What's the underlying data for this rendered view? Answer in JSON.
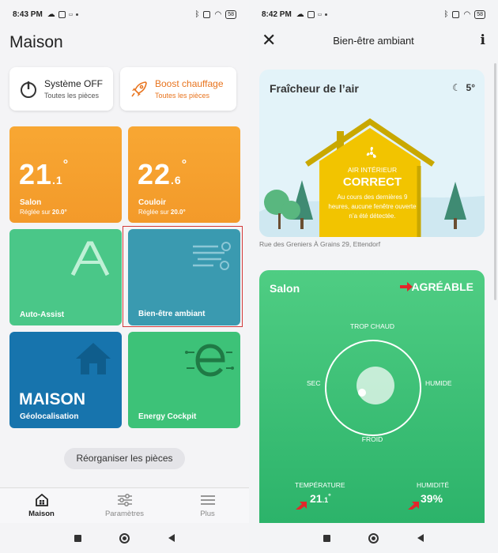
{
  "left": {
    "status": {
      "time": "8:43 PM",
      "battery": "58"
    },
    "title": "Maison",
    "quick": {
      "system": {
        "title": "Système OFF",
        "subtitle": "Toutes les pièces"
      },
      "boost": {
        "title": "Boost chauffage",
        "subtitle": "Toutes les pièces"
      }
    },
    "tiles": {
      "salon": {
        "int": "21",
        "dec": ".1",
        "deg": "°",
        "name": "Salon",
        "sub_prefix": "Réglée sur ",
        "sub_value": "20.0°"
      },
      "couloir": {
        "int": "22",
        "dec": ".6",
        "deg": "°",
        "name": "Couloir",
        "sub_prefix": "Réglée sur ",
        "sub_value": "20.0°"
      },
      "auto": {
        "name": "Auto-Assist"
      },
      "bienetre": {
        "name": "Bien-être ambiant"
      },
      "maison": {
        "big": "MAISON",
        "name": "Géolocalisation"
      },
      "energy": {
        "name": "Energy Cockpit"
      }
    },
    "reorganize": "Réorganiser les pièces",
    "nav": {
      "home": "Maison",
      "settings": "Paramètres",
      "more": "Plus"
    }
  },
  "right": {
    "status": {
      "time": "8:42 PM",
      "battery": "58"
    },
    "title": "Bien-être ambiant",
    "info": "i",
    "air": {
      "title": "Fraîcheur de l’air",
      "temp": "5°",
      "label": "AIR INTÉRIEUR",
      "status": "CORRECT",
      "desc": "Au cours des dernières 9 heures, aucune fenêtre ouverte n’a été détectée."
    },
    "address": "Rue des Greniers À Grains 29, Ettendorf",
    "salon": {
      "name": "Salon",
      "status": "AGRÉABLE",
      "top": "TROP CHAUD",
      "bottom": "FROID",
      "left": "SEC",
      "right": "HUMIDE",
      "temp_label": "TEMPÉRATURE",
      "temp_int": "21",
      "temp_dec": ".1",
      "temp_deg": "°",
      "hum_label": "HUMIDITÉ",
      "hum_value": "39%"
    }
  },
  "colors": {
    "orange": "#f39a2a",
    "green": "#4ac788",
    "teal": "#3a9ab0",
    "blue": "#1774ad",
    "red_arrow": "#e3262b",
    "boost": "#e8741e"
  }
}
